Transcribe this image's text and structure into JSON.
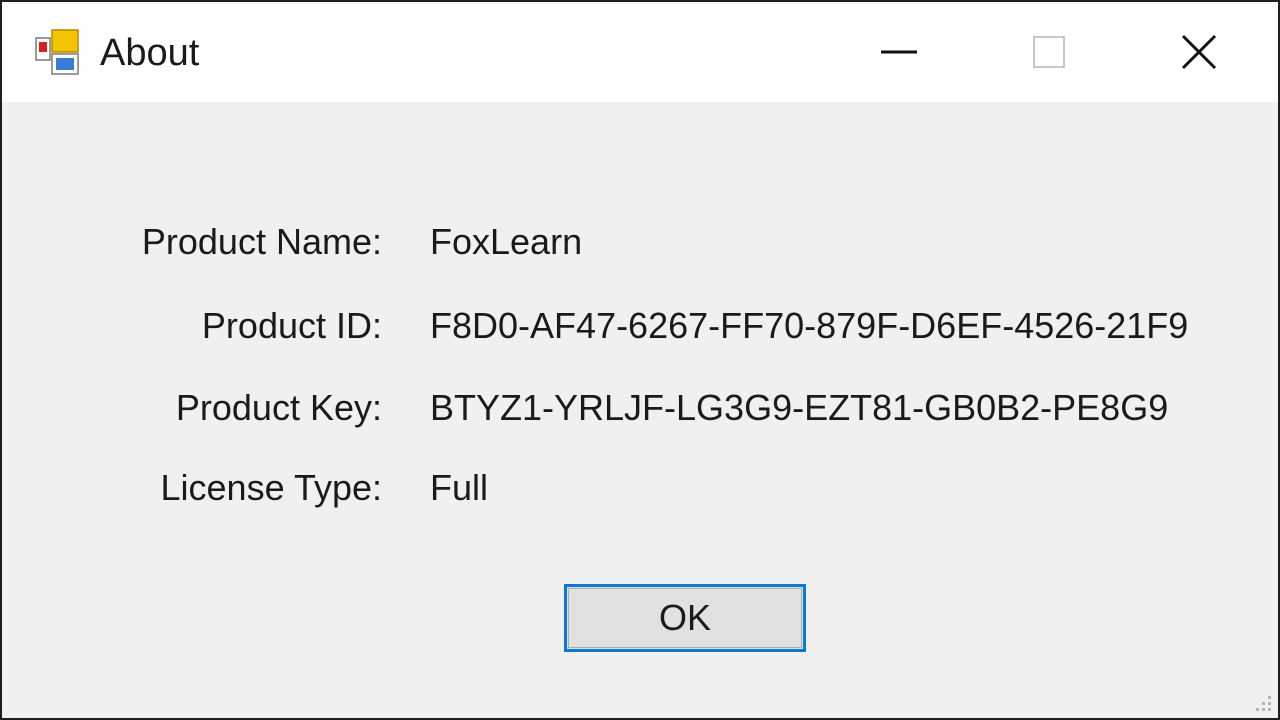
{
  "window": {
    "title": "About",
    "app_icon": "application-icon",
    "controls": [
      "minimize-icon",
      "maximize-icon",
      "close-icon"
    ]
  },
  "fields": [
    {
      "label": "Product Name:",
      "value": "FoxLearn"
    },
    {
      "label": "Product ID:",
      "value": "F8D0-AF47-6267-FF70-879F-D6EF-4526-21F9"
    },
    {
      "label": "Product Key:",
      "value": "BTYZ1-YRLJF-LG3G9-EZT81-GB0B2-PE8G9"
    },
    {
      "label": "License Type:",
      "value": "Full"
    }
  ],
  "ok_button": {
    "label": "OK"
  },
  "colors": {
    "focus_border": "#0a78d7",
    "dialog_background": "#f0f0f0",
    "button_face": "#e1e1e1"
  }
}
